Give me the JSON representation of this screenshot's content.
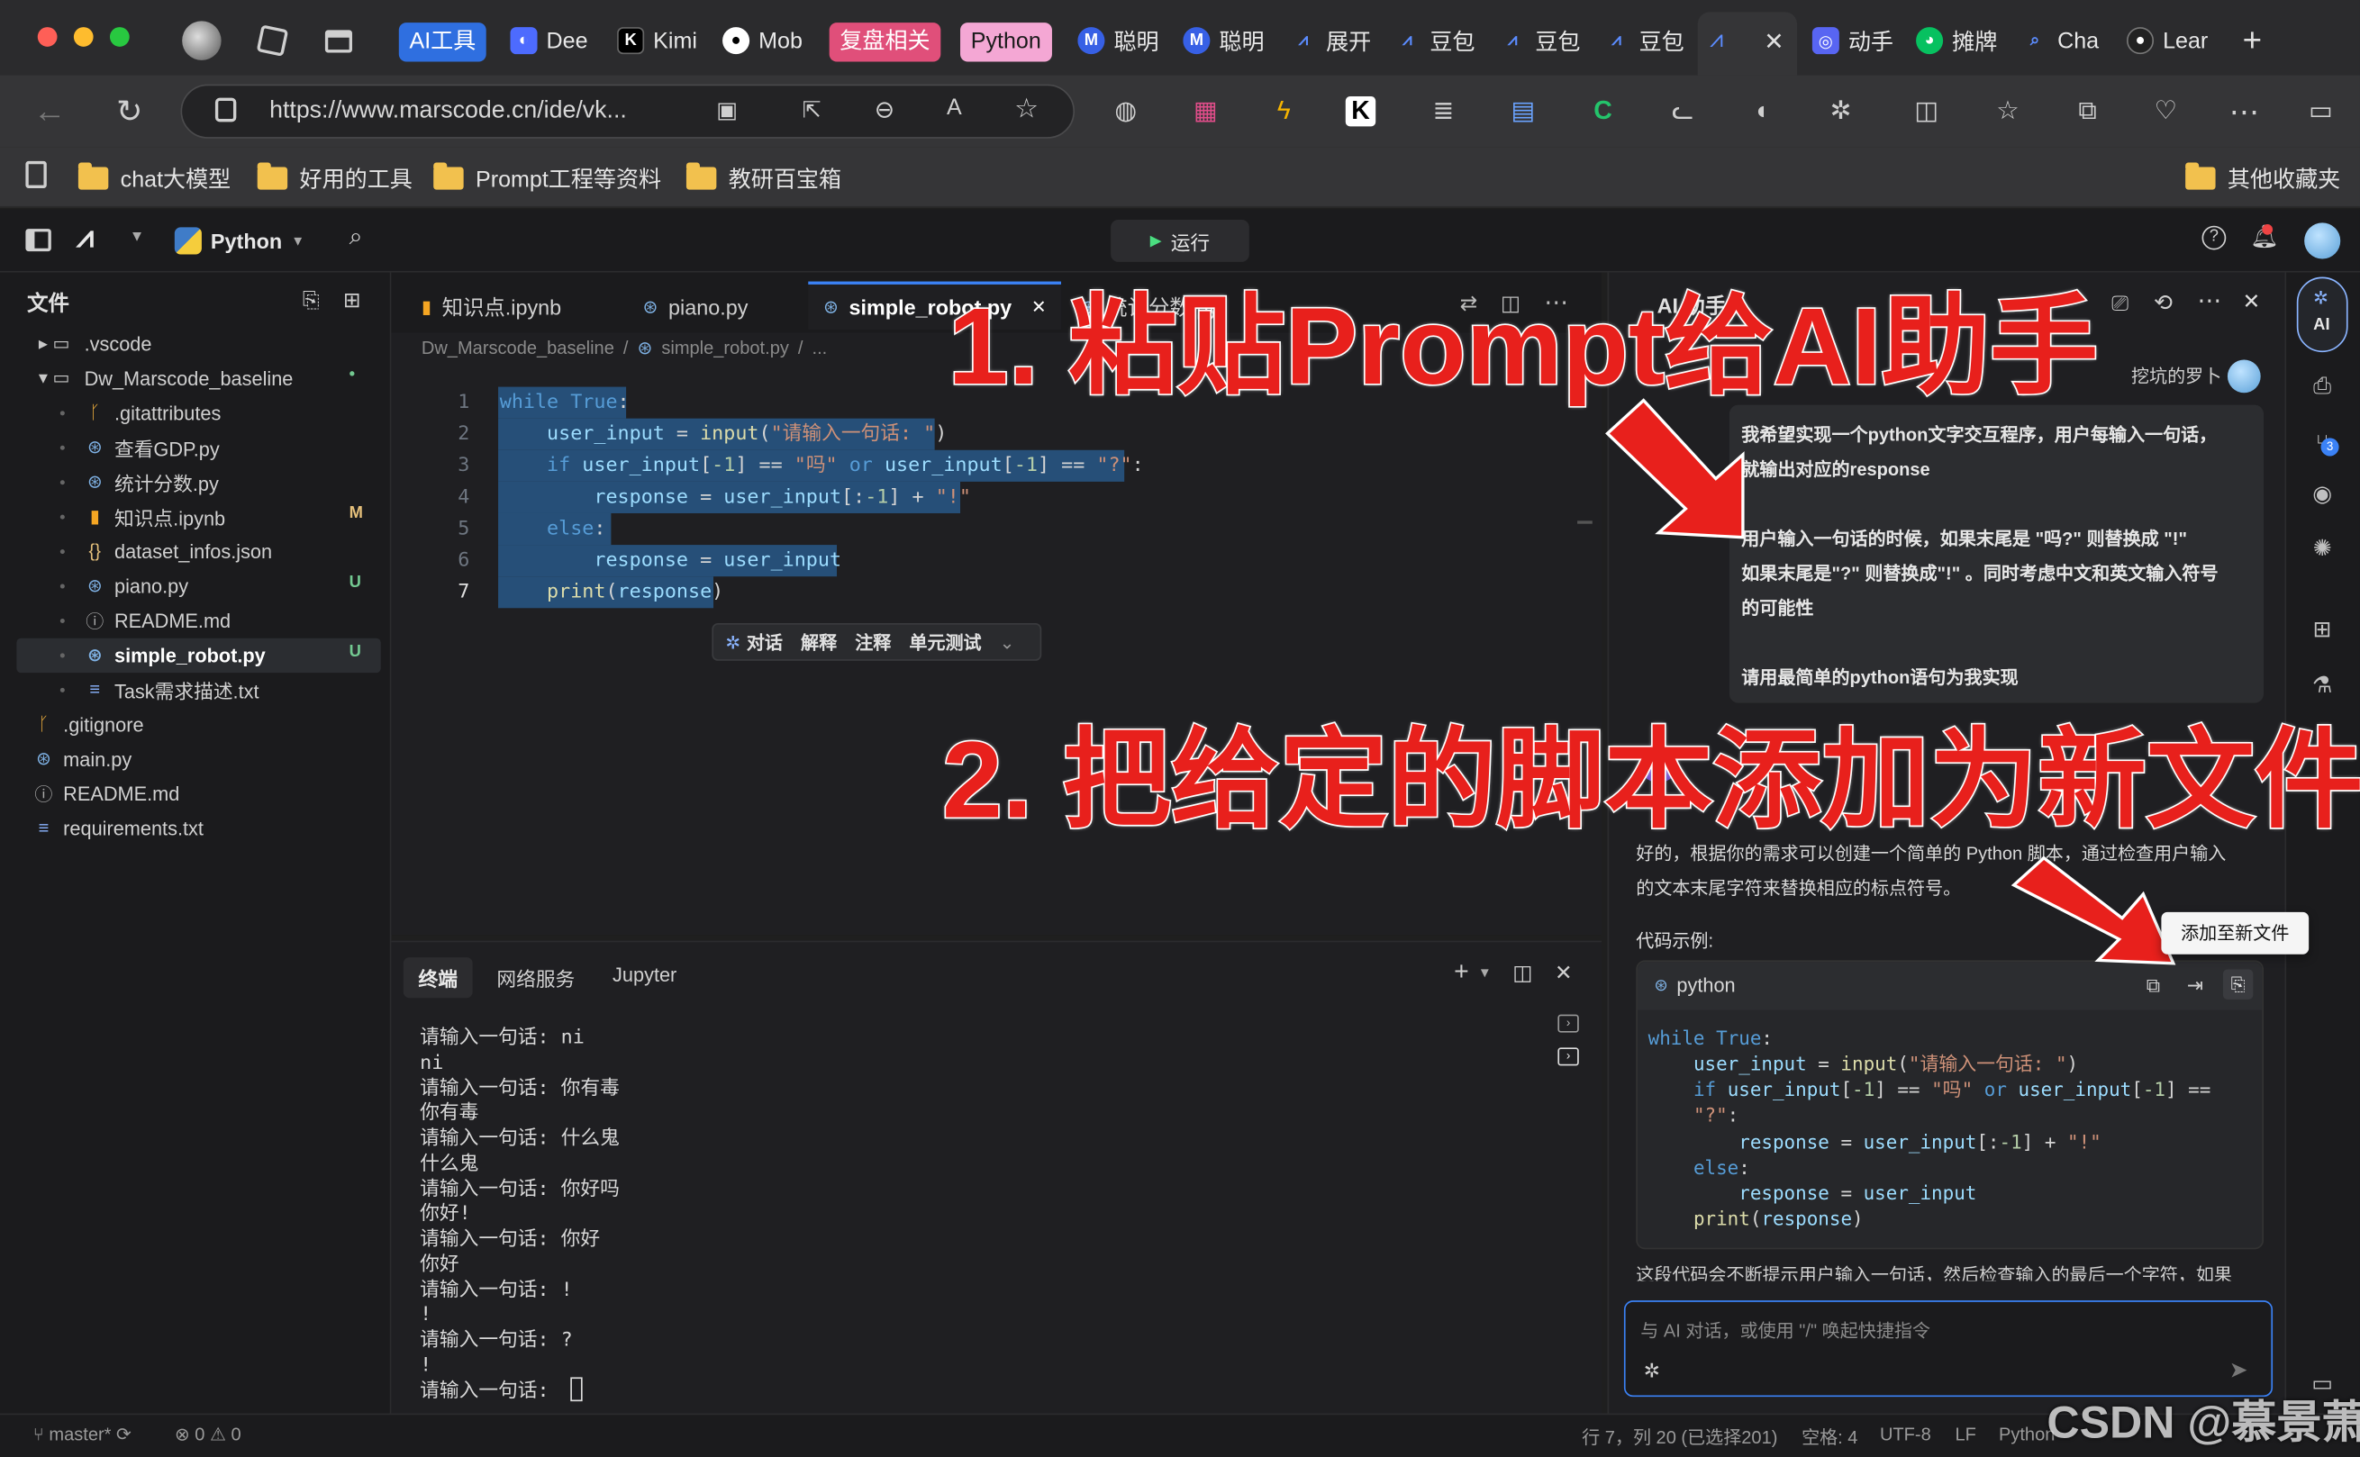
{
  "browser": {
    "tabs": [
      {
        "label": "AI工具",
        "kind": "group",
        "color": "#2f6fe0"
      },
      {
        "label": "Dee",
        "icon": "deepseek-icon"
      },
      {
        "label": "Kimi",
        "icon": "kimi-icon"
      },
      {
        "label": "Mob",
        "icon": "github-icon"
      },
      {
        "label": "复盘相关",
        "kind": "group",
        "color": "#e04f7a"
      },
      {
        "label": "Python",
        "kind": "group",
        "color": "#f4a7d4"
      },
      {
        "label": "聪明",
        "icon": "metaso-icon"
      },
      {
        "label": "聪明",
        "icon": "metaso-icon"
      },
      {
        "label": "展开",
        "icon": "marscode-icon"
      },
      {
        "label": "豆包",
        "icon": "marscode-icon"
      },
      {
        "label": "豆包",
        "icon": "marscode-icon"
      },
      {
        "label": "豆包",
        "icon": "marscode-icon"
      },
      {
        "label": "",
        "icon": "marscode-icon",
        "active": true
      },
      {
        "label": "动手",
        "icon": "discord-icon"
      },
      {
        "label": "摊牌",
        "icon": "wechat-icon"
      },
      {
        "label": "Cha",
        "icon": "search-icon"
      },
      {
        "label": "Lear",
        "icon": "github-icon"
      }
    ],
    "url": "https://www.marscode.cn/ide/vk...",
    "bookmarks": [
      "chat大模型",
      "好用的工具",
      "Prompt工程等资料",
      "教研百宝箱"
    ],
    "other_bookmarks": "其他收藏夹"
  },
  "ide": {
    "language": "Python",
    "run_label": "运行",
    "explorer_title": "文件",
    "files": [
      {
        "name": ".vscode",
        "depth": 0,
        "type": "folder-closed",
        "badge": ""
      },
      {
        "name": "Dw_Marscode_baseline",
        "depth": 0,
        "type": "folder-open",
        "badge": "•"
      },
      {
        "name": ".gitattributes",
        "depth": 1,
        "type": "git",
        "badge": ""
      },
      {
        "name": "查看GDP.py",
        "depth": 1,
        "type": "python",
        "badge": ""
      },
      {
        "name": "统计分数.py",
        "depth": 1,
        "type": "python",
        "badge": ""
      },
      {
        "name": "知识点.ipynb",
        "depth": 1,
        "type": "notebook",
        "badge": "M"
      },
      {
        "name": "dataset_infos.json",
        "depth": 1,
        "type": "json",
        "badge": ""
      },
      {
        "name": "piano.py",
        "depth": 1,
        "type": "python",
        "badge": "U"
      },
      {
        "name": "README.md",
        "depth": 1,
        "type": "readme",
        "badge": ""
      },
      {
        "name": "simple_robot.py",
        "depth": 1,
        "type": "python",
        "badge": "U",
        "selected": true
      },
      {
        "name": "Task需求描述.txt",
        "depth": 1,
        "type": "text",
        "badge": ""
      },
      {
        "name": ".gitignore",
        "depth": 0,
        "type": "git",
        "badge": ""
      },
      {
        "name": "main.py",
        "depth": 0,
        "type": "python",
        "badge": ""
      },
      {
        "name": "README.md",
        "depth": 0,
        "type": "readme",
        "badge": ""
      },
      {
        "name": "requirements.txt",
        "depth": 0,
        "type": "text",
        "badge": ""
      }
    ],
    "editor_tabs": [
      {
        "label": "知识点.ipynb",
        "icon": "notebook-icon"
      },
      {
        "label": "piano.py",
        "icon": "python-icon"
      },
      {
        "label": "simple_robot.py",
        "icon": "python-icon",
        "active": true
      },
      {
        "label": "统计分数.py",
        "icon": "python-icon"
      }
    ],
    "breadcrumb": [
      "Dw_Marscode_baseline",
      "simple_robot.py",
      "..."
    ],
    "code_lines": [
      "while True:",
      "    user_input = input(\"请输入一句话: \")",
      "    if user_input[-1] == \"吗\" or user_input[-1] == \"?\":",
      "        response = user_input[:-1] + \"!\"",
      "    else:",
      "        response = user_input",
      "    print(response)"
    ],
    "code_actions": [
      "对话",
      "解释",
      "注释",
      "单元测试"
    ],
    "terminal_tabs": [
      "终端",
      "网络服务",
      "Jupyter"
    ],
    "terminal_lines": [
      "请输入一句话: ni",
      "ni",
      "请输入一句话: 你有毒",
      "你有毒",
      "请输入一句话: 什么鬼",
      "什么鬼",
      "请输入一句话: 你好吗",
      "你好!",
      "请输入一句话: 你好",
      "你好",
      "请输入一句话: !",
      "!",
      "请输入一句话: ?",
      "!",
      "请输入一句话: "
    ],
    "ai_title": "AI 助手",
    "user_name": "挖坑的罗卜",
    "user_message": [
      "我希望实现一个python文字交互程序，用户每输入一句话，",
      "就输出对应的response",
      "",
      "用户输入一句话的时候，如果末尾是 \"吗?\" 则替换成 \"!\"",
      "如果末尾是\"?\" 则替换成\"!\" 。同时考虑中文和英文输入符号",
      "的可能性",
      "",
      "请用最简单的python语句为我实现"
    ],
    "ai_reply": [
      "好的，根据你的需求可以创建一个简单的 Python 脚本，通过检查用户输入",
      "的文本末尾字符来替换相应的标点符号。"
    ],
    "code_example_label": "代码示例:",
    "code_block_lang": "python",
    "code_block_lines": [
      "while True:",
      "    user_input = input(\"请输入一句话: \")",
      "    if user_input[-1] == \"吗\" or user_input[-1] ==",
      "    \"?\":",
      "        response = user_input[:-1] + \"!\"",
      "    else:",
      "        response = user_input",
      "    print(response)"
    ],
    "add_file_tooltip": "添加至新文件",
    "tail_text": "这段代码会不断提示用户输入一句话，然后检查输入的最后一个字符，如果",
    "chat_placeholder": "与 AI 对话，或使用 \"/\" 唤起快捷指令",
    "status": {
      "branch": "master*",
      "errors": "0",
      "warnings": "0",
      "cursor": "行 7，列 20 (已选择201)",
      "spaces": "空格: 4",
      "encoding": "UTF-8",
      "eol": "LF",
      "lang": "Python"
    }
  },
  "annotations": {
    "step1": "1. 粘贴Prompt给AI助手",
    "step2": "2. 把给定的脚本添加为新文件"
  },
  "watermark": "CSDN @慕景萧",
  "colors": {
    "annotation": "#e8201c",
    "accent": "#3b82f6",
    "selection": "#264f78"
  }
}
